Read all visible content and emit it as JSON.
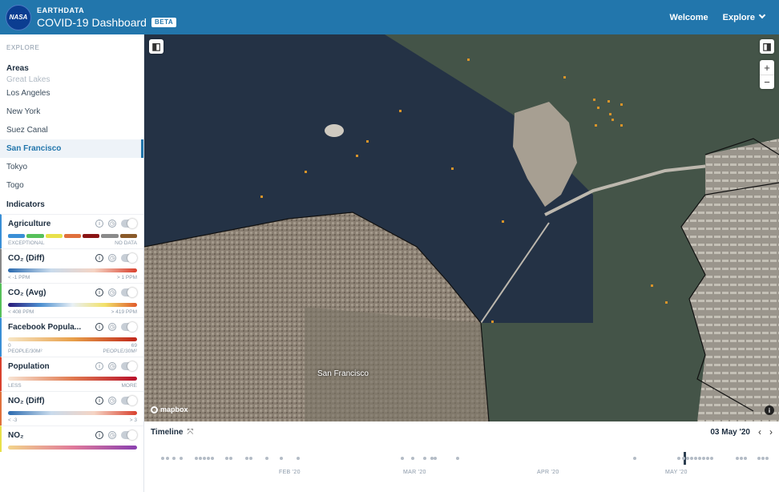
{
  "header": {
    "logo_text": "NASA",
    "brand_small": "EARTHDATA",
    "title": "COVID-19 Dashboard",
    "badge": "BETA",
    "nav": {
      "welcome": "Welcome",
      "explore": "Explore"
    }
  },
  "sidebar": {
    "explore_label": "EXPLORE",
    "areas_heading": "Areas",
    "areas": [
      {
        "label": "Great Lakes"
      },
      {
        "label": "Los Angeles"
      },
      {
        "label": "New York"
      },
      {
        "label": "Suez Canal"
      },
      {
        "label": "San Francisco"
      },
      {
        "label": "Tokyo"
      },
      {
        "label": "Togo"
      }
    ],
    "indicators_heading": "Indicators",
    "indicators": [
      {
        "name": "Agriculture",
        "low": "EXCEPTIONAL",
        "high": "NO DATA"
      },
      {
        "name": "CO₂ (Diff)",
        "low": "< -1 PPM",
        "high": "> 1 PPM"
      },
      {
        "name": "CO₂ (Avg)",
        "low": "< 408 PPM",
        "high": "> 419 PPM"
      },
      {
        "name": "Facebook Popula...",
        "low": "0",
        "high": "69",
        "low2": "PEOPLE/30M²",
        "high2": "PEOPLE/30M²"
      },
      {
        "name": "Population",
        "low": "LESS",
        "high": "MORE"
      },
      {
        "name": "NO₂ (Diff)",
        "low": "< -3",
        "high": "> 3"
      },
      {
        "name": "NO₂",
        "low": "",
        "high": ""
      }
    ]
  },
  "map": {
    "place_label": "San Francisco",
    "attribution": "mapbox",
    "zoom_in": "+",
    "zoom_out": "−",
    "info": "i"
  },
  "timeline": {
    "title": "Timeline",
    "current_date": "03 May '20",
    "months": [
      "FEB '20",
      "MAR '20",
      "APR '20",
      "MAY '20"
    ]
  },
  "colors": {
    "header_bg": "#2276ac",
    "active_area": "#2276ac",
    "agriculture_swatches": [
      "#3a8fd6",
      "#56c05a",
      "#e8e14a",
      "#e0703c",
      "#8a1414",
      "#8a8a8a",
      "#8a5a2a"
    ]
  }
}
